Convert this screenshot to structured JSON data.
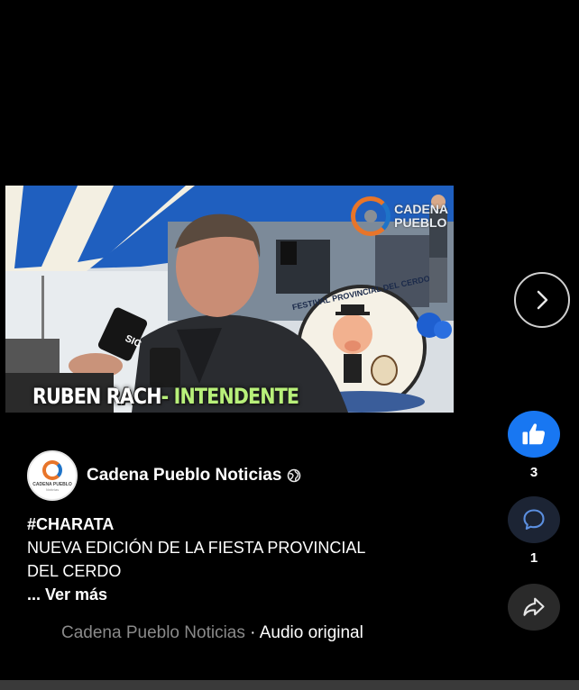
{
  "video": {
    "caption_name": "RUBEN RACH",
    "caption_sep": "- ",
    "caption_role": "INTENDENTE",
    "watermark_line1": "CADENA",
    "watermark_line2": "PUEBLO",
    "banner_text": "FESTIVAL PROVINCIAL DEL CERDO",
    "mic_text": "SIC"
  },
  "author": {
    "name": "Cadena Pueblo Noticias",
    "avatar_line1": "CADENA PUEBLO",
    "avatar_line2": "Noticias",
    "privacy_icon": "globe-icon"
  },
  "post": {
    "hashtag": "#CHARATA",
    "line1": "NUEVA EDICIÓN DE LA FIESTA PROVINCIAL",
    "line2": "DEL CERDO",
    "see_more": "... Ver más"
  },
  "audio": {
    "source": "Cadena Pueblo Noticias",
    "sep": " · ",
    "label": "Audio original"
  },
  "actions": {
    "like_icon": "thumbs-up-icon",
    "like_count": "3",
    "comment_icon": "comment-icon",
    "comment_count": "1",
    "share_icon": "share-icon"
  },
  "navigation": {
    "next_icon": "chevron-right-icon"
  },
  "colors": {
    "like_blue": "#1877f2",
    "caption_accent": "#b8f07a",
    "brand_orange": "#e8752a",
    "brand_blue": "#1e73c8"
  }
}
